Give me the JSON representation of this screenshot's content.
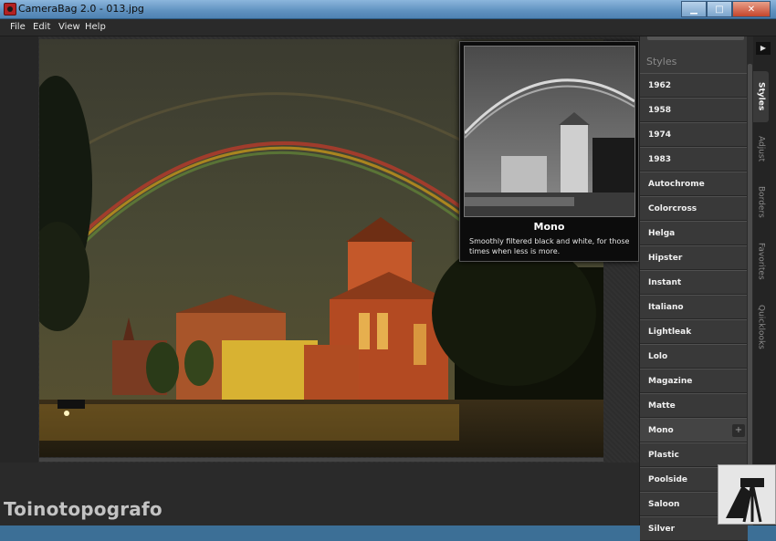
{
  "window": {
    "title": "CameraBag 2.0 - 013.jpg",
    "minimize_glyph": "▁",
    "maximize_glyph": "□",
    "close_glyph": "✕"
  },
  "menu": [
    "File",
    "Edit",
    "View",
    "Help"
  ],
  "preview": {
    "name": "Mono",
    "description": "Smoothly filtered black and white, for those times when less is more."
  },
  "panel": {
    "heading": "Styles",
    "collapse_glyph": "▶",
    "plus_glyph": "+",
    "styles": [
      "1962",
      "1958",
      "1974",
      "1983",
      "Autochrome",
      "Colorcross",
      "Helga",
      "Hipster",
      "Instant",
      "Italiano",
      "Lightleak",
      "Lolo",
      "Magazine",
      "Matte",
      "Mono",
      "Plastic",
      "Poolside",
      "Saloon",
      "Silver"
    ],
    "selected": "Mono"
  },
  "tabs": [
    "Styles",
    "Adjust",
    "Borders",
    "Favorites",
    "Quicklooks"
  ],
  "active_tab": "Styles",
  "watermark": "Toinotopografo",
  "icons": {
    "app": "camerabag-app-icon",
    "collapse": "triangle-right-icon",
    "plus": "plus-icon"
  }
}
